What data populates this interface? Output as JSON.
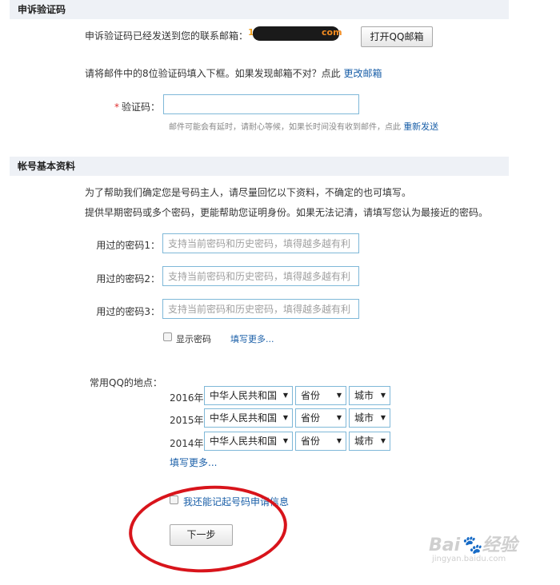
{
  "verify_section": {
    "title": "申诉验证码",
    "sent_text": "申诉验证码已经发送到您的联系邮箱：",
    "email_prefix": "1",
    "email_suffix": "com",
    "open_qq_mail_button": "打开QQ邮箱",
    "instruction": "请将邮件中的8位验证码填入下框。如果发现邮箱不对？点此",
    "change_email_link": "更改邮箱",
    "code_label": "验证码：",
    "code_required_mark": "*",
    "code_value": "",
    "hint": "邮件可能会有延时，请耐心等候，如果长时间没有收到邮件，点此",
    "resend_link": "重新发送"
  },
  "account_section": {
    "title": "帐号基本资料",
    "intro_line1": "为了帮助我们确定您是号码主人，请尽量回忆以下资料，不确定的也可填写。",
    "intro_line2": "提供早期密码或多个密码，更能帮助您证明身份。如果无法记清，请填写您认为最接近的密码。",
    "passwords": [
      {
        "label": "用过的密码1：",
        "placeholder": "支持当前密码和历史密码，填得越多越有利"
      },
      {
        "label": "用过的密码2：",
        "placeholder": "支持当前密码和历史密码，填得越多越有利"
      },
      {
        "label": "用过的密码3：",
        "placeholder": "支持当前密码和历史密码，填得越多越有利"
      }
    ],
    "show_password_label": "显示密码",
    "fill_more_passwords": "填写更多...",
    "location_label": "常用QQ的地点：",
    "locations": [
      {
        "year": "2016年",
        "country": "中华人民共和国",
        "province": "省份",
        "city": "城市"
      },
      {
        "year": "2015年",
        "country": "中华人民共和国",
        "province": "省份",
        "city": "城市"
      },
      {
        "year": "2014年",
        "country": "中华人民共和国",
        "province": "省份",
        "city": "城市"
      }
    ],
    "fill_more_locations": "填写更多...",
    "remember_application": "我还能记起号码申请信息",
    "next_button": "下一步"
  },
  "watermark": {
    "brand": "Bai",
    "brand_mid": "经验",
    "url": "jingyan.baidu.com"
  },
  "colors": {
    "section_bg": "#eef1f6",
    "link": "#1a5fa8",
    "input_border": "#7fb8d8",
    "annotation_red": "#d8141b"
  }
}
